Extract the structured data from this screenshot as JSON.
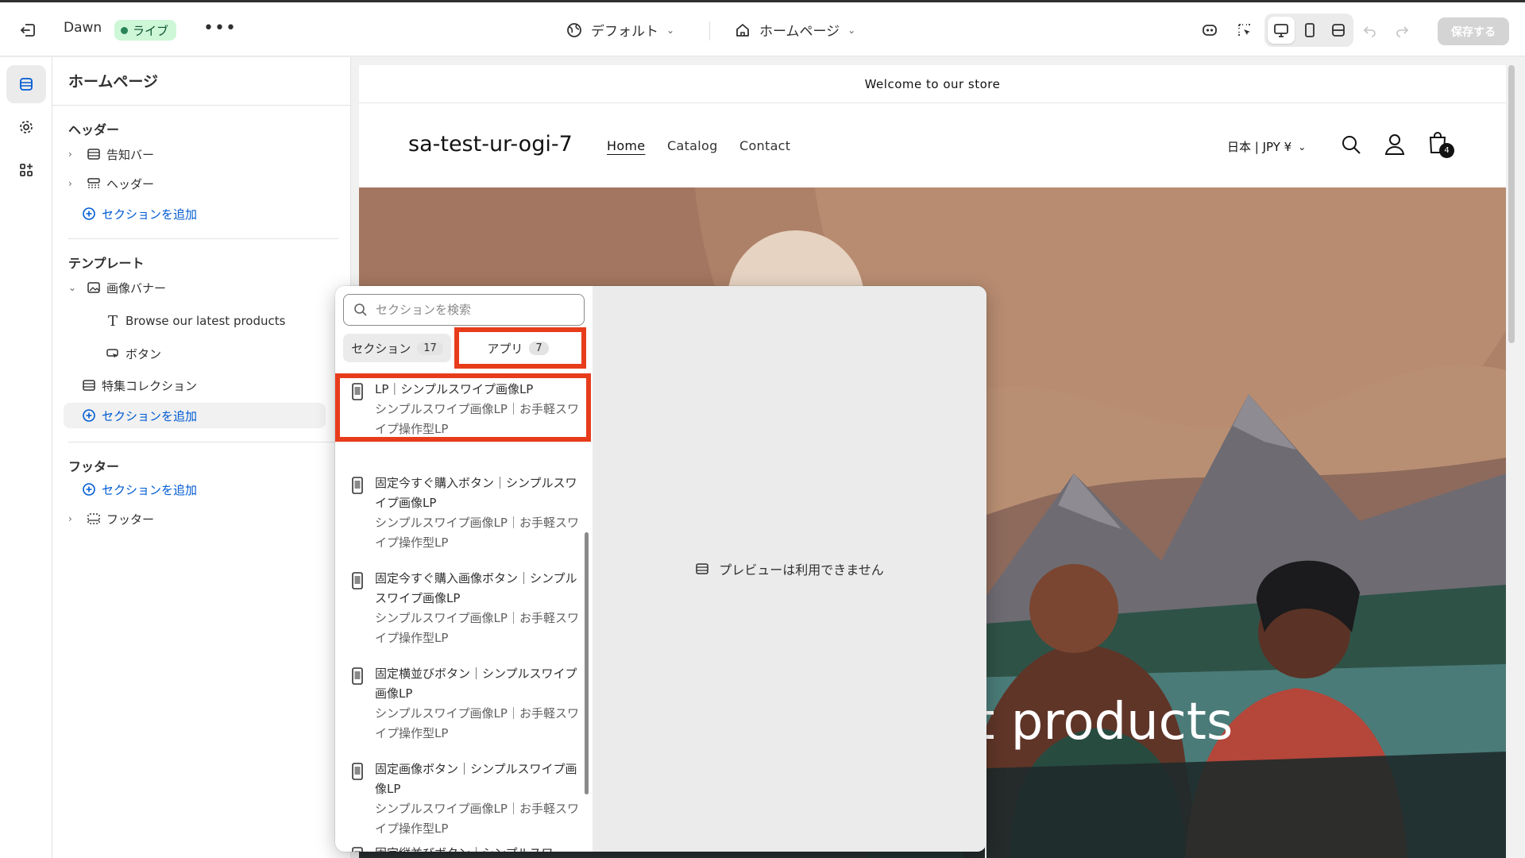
{
  "topbar": {
    "theme_name": "Dawn",
    "live_badge": "ライブ",
    "more": "•••",
    "preset_dropdown": "デフォルト",
    "page_dropdown": "ホームページ",
    "save_label": "保存する"
  },
  "sidebar": {
    "title": "ホームページ",
    "header_group": "ヘッダー",
    "header_items": [
      "告知バー",
      "ヘッダー"
    ],
    "add_section": "セクションを追加",
    "template_group": "テンプレート",
    "template_items": {
      "image_banner": "画像バナー",
      "banner_text": "Browse our latest products",
      "banner_button": "ボタン",
      "featured_collection": "特集コレクション"
    },
    "footer_group": "フッター",
    "footer_item": "フッター"
  },
  "preview": {
    "announcement": "Welcome to our store",
    "store_name": "sa-test-ur-ogi-7",
    "nav": [
      "Home",
      "Catalog",
      "Contact"
    ],
    "locale": "日本 | JPY ¥",
    "cart_count": "4",
    "hero_text": "st products"
  },
  "picker": {
    "search_placeholder": "セクションを検索",
    "tab_sections": "セクション",
    "tab_sections_count": "17",
    "tab_apps": "アプリ",
    "tab_apps_count": "7",
    "no_preview": "プレビューは利用できません",
    "apps": [
      {
        "name": "LP｜シンプルスワイプ画像LP",
        "desc": "シンプルスワイプ画像LP｜お手軽スワイプ操作型LP"
      },
      {
        "name": "固定今すぐ購入ボタン｜シンプルスワイプ画像LP",
        "desc": "シンプルスワイプ画像LP｜お手軽スワイプ操作型LP"
      },
      {
        "name": "固定今すぐ購入画像ボタン｜シンプルスワイプ画像LP",
        "desc": "シンプルスワイプ画像LP｜お手軽スワイプ操作型LP"
      },
      {
        "name": "固定横並びボタン｜シンプルスワイプ画像LP",
        "desc": "シンプルスワイプ画像LP｜お手軽スワイプ操作型LP"
      },
      {
        "name": "固定画像ボタン｜シンプルスワイプ画像LP",
        "desc": "シンプルスワイプ画像LP｜お手軽スワイプ操作型LP"
      },
      {
        "name": "固定縦並びボタン｜シンプルスワ",
        "desc": ""
      }
    ]
  },
  "colors": {
    "accent_blue": "#005bd3",
    "live_green": "#29845a",
    "highlight_red": "#e73c1c"
  }
}
